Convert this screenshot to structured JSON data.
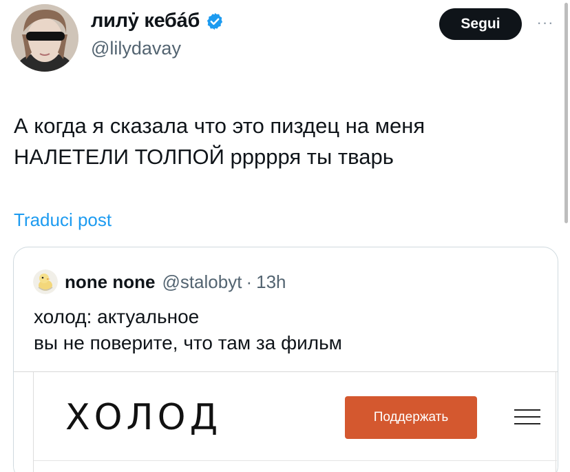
{
  "author": {
    "display_name": "лилẏ кебáб",
    "handle": "@lilydavay",
    "verified": true,
    "follow_label": "Segui",
    "more_label": "···"
  },
  "tweet": {
    "text_lines": [
      "А когда я сказала что это пиздец на меня",
      "НАЛЕТЕЛИ ТОЛПОЙ ррррря ты тварь"
    ],
    "translate_label": "Traduci post"
  },
  "quoted": {
    "display_name": "none none",
    "handle": "@stalobyt",
    "separator": "·",
    "time": "13h",
    "text_lines": [
      "холод: актуальное",
      "вы не поверите, что там за фильм"
    ],
    "preview": {
      "brand": "ХОЛОД",
      "support_label": "Поддержать"
    }
  },
  "colors": {
    "link": "#1d9bf0",
    "verified": "#1d9bf0",
    "follow_bg": "#0f1419",
    "support_bg": "#d4582f",
    "muted": "#536471"
  }
}
